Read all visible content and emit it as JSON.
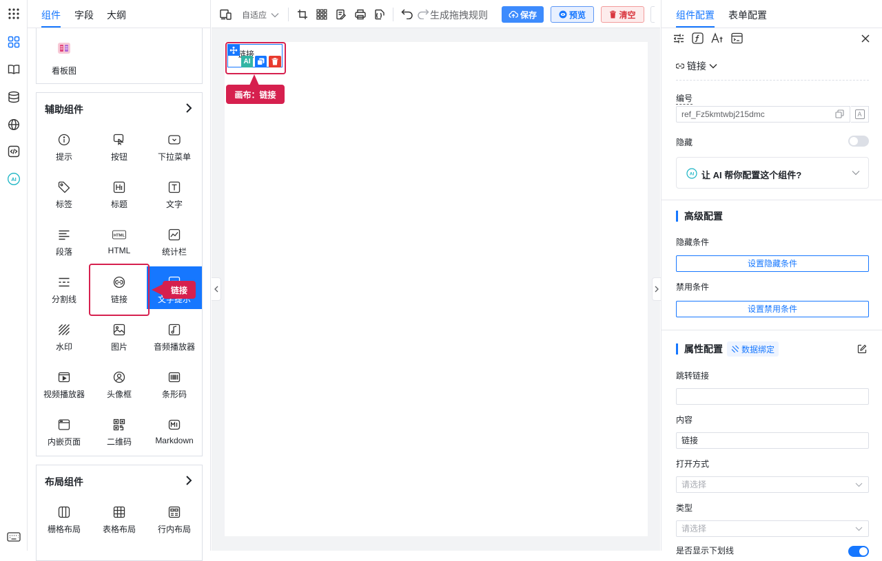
{
  "left_tabs": [
    "组件",
    "字段",
    "大纲"
  ],
  "sections": {
    "top_partial": {
      "items": [
        {
          "label": "看板图",
          "icon": "kanban-icon"
        }
      ]
    },
    "aux": {
      "title": "辅助组件",
      "items": [
        {
          "label": "提示",
          "icon": "info-icon"
        },
        {
          "label": "按钮",
          "icon": "button-icon"
        },
        {
          "label": "下拉菜单",
          "icon": "dropdown-icon"
        },
        {
          "label": "标签",
          "icon": "tag-icon"
        },
        {
          "label": "标题",
          "icon": "heading-icon"
        },
        {
          "label": "文字",
          "icon": "text-icon"
        },
        {
          "label": "段落",
          "icon": "paragraph-icon"
        },
        {
          "label": "HTML",
          "icon": "html-icon"
        },
        {
          "label": "统计栏",
          "icon": "statistic-icon"
        },
        {
          "label": "分割线",
          "icon": "divider-icon"
        },
        {
          "label": "链接",
          "icon": "link-icon"
        },
        {
          "label": "文字提示",
          "icon": "tooltip-icon"
        },
        {
          "label": "水印",
          "icon": "watermark-icon"
        },
        {
          "label": "图片",
          "icon": "image-icon"
        },
        {
          "label": "音频播放器",
          "icon": "audio-icon"
        },
        {
          "label": "视频播放器",
          "icon": "video-icon"
        },
        {
          "label": "头像框",
          "icon": "avatar-icon"
        },
        {
          "label": "条形码",
          "icon": "barcode-icon"
        },
        {
          "label": "内嵌页面",
          "icon": "iframe-icon"
        },
        {
          "label": "二维码",
          "icon": "qrcode-icon"
        },
        {
          "label": "Markdown",
          "icon": "markdown-icon"
        }
      ]
    },
    "layout": {
      "title": "布局组件",
      "items": [
        {
          "label": "栅格布局",
          "icon": "grid-layout-icon"
        },
        {
          "label": "表格布局",
          "icon": "table-layout-icon"
        },
        {
          "label": "行内布局",
          "icon": "inline-layout-icon"
        }
      ]
    }
  },
  "drag_tooltip": "链接",
  "toolbar": {
    "device_mode": "自适应",
    "rules_label": "生成拖拽规则",
    "save_label": "保存",
    "preview_label": "预览",
    "clear_label": "清空"
  },
  "canvas": {
    "item_text": "链接",
    "ai_badge": "AI",
    "label": "画布：链接"
  },
  "right_tabs": [
    "组件配置",
    "表单配置"
  ],
  "right": {
    "component_type": "链接",
    "id_label": "编号",
    "id_value": "ref_Fz5kmtwbj215dmc",
    "id_badge": "A",
    "hidden_label": "隐藏",
    "ai_prompt": "让 AI 帮你配置这个组件?",
    "ai_badge": "AI",
    "advanced_title": "高级配置",
    "hide_cond_label": "隐藏条件",
    "hide_cond_btn": "设置隐藏条件",
    "disable_cond_label": "禁用条件",
    "disable_cond_btn": "设置禁用条件",
    "props_title": "属性配置",
    "data_bind_label": "数据绑定",
    "url_label": "跳转链接",
    "url_value": "",
    "content_label": "内容",
    "content_value": "链接",
    "open_mode_label": "打开方式",
    "open_mode_placeholder": "请选择",
    "type_label": "类型",
    "type_placeholder": "请选择",
    "underline_label": "是否显示下划线"
  },
  "colors": {
    "accent": "#1677ff",
    "danger": "#d6204e",
    "border": "#e5e6eb"
  }
}
